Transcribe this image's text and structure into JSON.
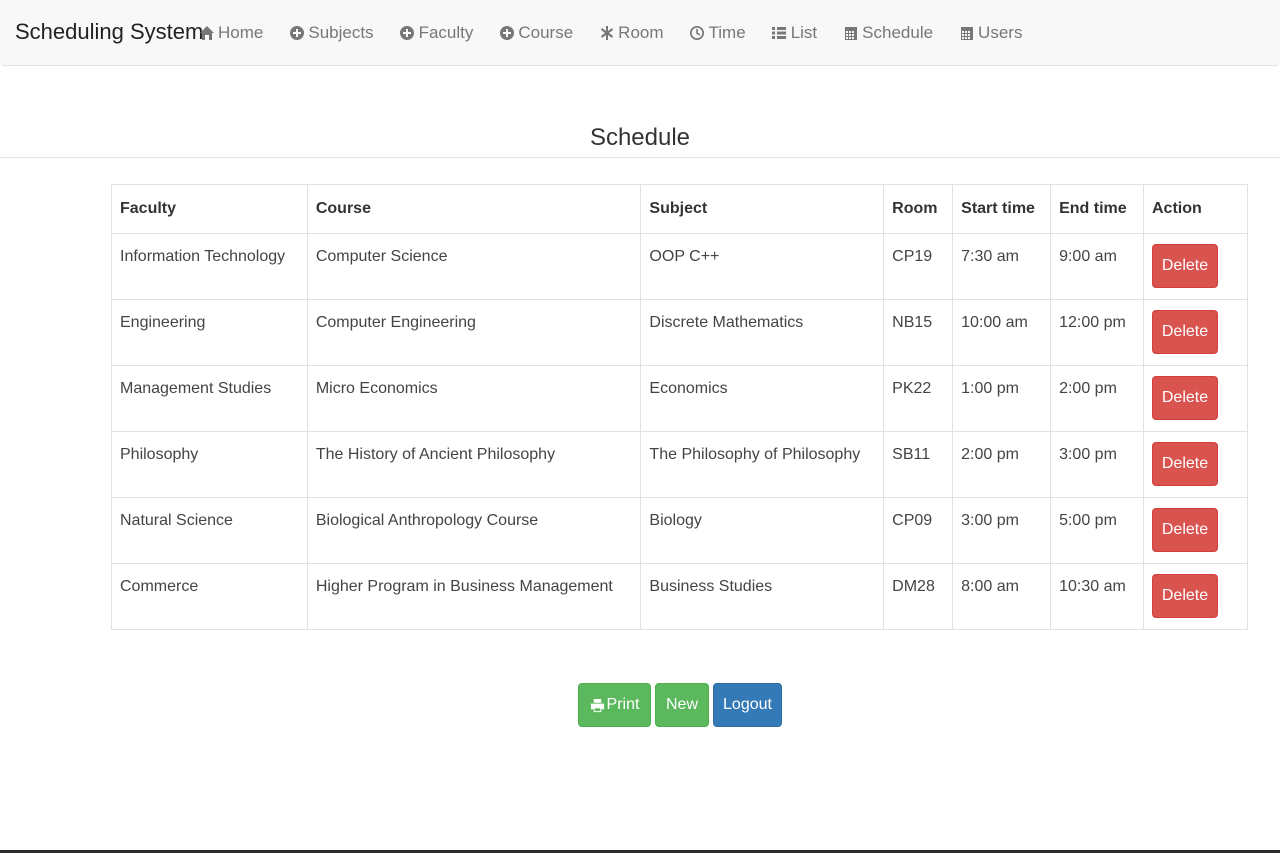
{
  "app": {
    "brand": "Scheduling System"
  },
  "nav": [
    {
      "label": "Home",
      "icon": "home-icon"
    },
    {
      "label": "Subjects",
      "icon": "plus-circle-icon"
    },
    {
      "label": "Faculty",
      "icon": "plus-circle-icon"
    },
    {
      "label": "Course",
      "icon": "plus-circle-icon"
    },
    {
      "label": "Room",
      "icon": "asterisk-icon"
    },
    {
      "label": "Time",
      "icon": "clock-icon"
    },
    {
      "label": "List",
      "icon": "list-icon"
    },
    {
      "label": "Schedule",
      "icon": "calendar-icon"
    },
    {
      "label": "Users",
      "icon": "calendar-icon"
    }
  ],
  "page": {
    "title": "Schedule"
  },
  "table": {
    "headers": [
      "Faculty",
      "Course",
      "Subject",
      "Room",
      "Start time",
      "End time",
      "Action"
    ],
    "rows": [
      {
        "faculty": "Information Technology",
        "course": "Computer Science",
        "subject": "OOP C++",
        "room": "CP19",
        "start": "7:30 am",
        "end": "9:00 am",
        "action": "Delete"
      },
      {
        "faculty": "Engineering",
        "course": "Computer Engineering",
        "subject": "Discrete Mathematics",
        "room": "NB15",
        "start": "10:00 am",
        "end": "12:00 pm",
        "action": "Delete"
      },
      {
        "faculty": "Management Studies",
        "course": "Micro Economics",
        "subject": "Economics",
        "room": "PK22",
        "start": "1:00 pm",
        "end": "2:00 pm",
        "action": "Delete"
      },
      {
        "faculty": "Philosophy",
        "course": "The History of Ancient Philosophy",
        "subject": "The Philosophy of Philosophy",
        "room": "SB11",
        "start": "2:00 pm",
        "end": "3:00 pm",
        "action": "Delete"
      },
      {
        "faculty": "Natural Science",
        "course": "Biological Anthropology Course",
        "subject": "Biology",
        "room": "CP09",
        "start": "3:00 pm",
        "end": "5:00 pm",
        "action": "Delete"
      },
      {
        "faculty": "Commerce",
        "course": "Higher Program in Business Management",
        "subject": "Business Studies",
        "room": "DM28",
        "start": "8:00 am",
        "end": "10:30 am",
        "action": "Delete"
      }
    ]
  },
  "buttons": {
    "print": "Print",
    "new": "New",
    "logout": "Logout"
  },
  "colors": {
    "danger": "#d9534f",
    "success": "#5cb85c",
    "primary": "#337ab7"
  }
}
